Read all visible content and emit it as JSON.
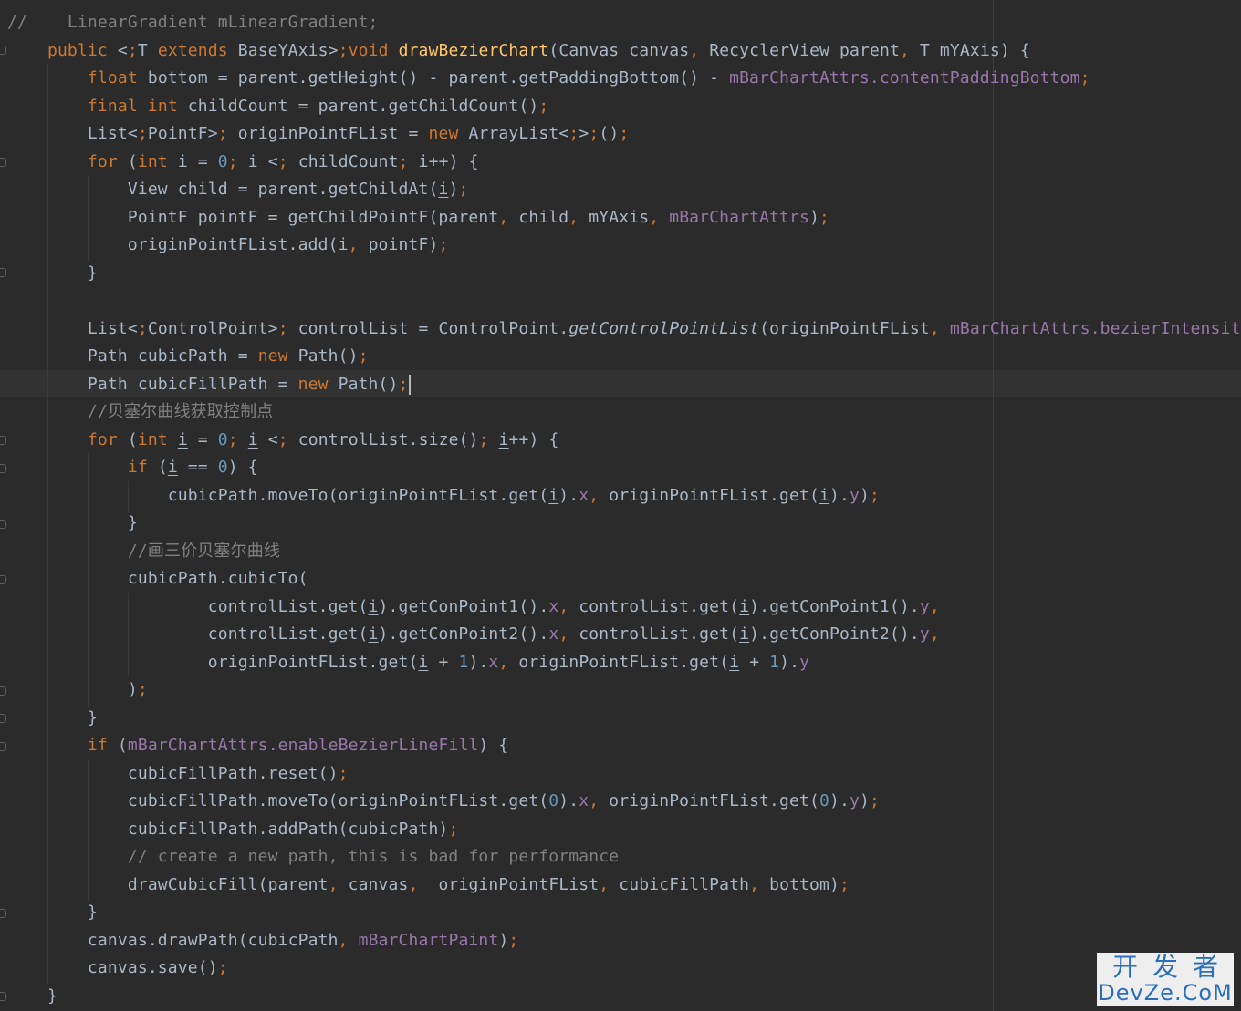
{
  "editor": {
    "lines": [
      "//    LinearGradient mLinearGradient;",
      "    public <T extends BaseYAxis>void drawBezierChart(Canvas canvas, RecyclerView parent, T mYAxis) {",
      "        float bottom = parent.getHeight() - parent.getPaddingBottom() - mBarChartAttrs.contentPaddingBottom;",
      "        final int childCount = parent.getChildCount();",
      "        List<PointF> originPointFList = new ArrayList<>();",
      "        for (int i = 0; i < childCount; i++) {",
      "            View child = parent.getChildAt(i);",
      "            PointF pointF = getChildPointF(parent, child, mYAxis, mBarChartAttrs);",
      "            originPointFList.add(i, pointF);",
      "        }",
      "",
      "        List<ControlPoint> controlList = ControlPoint.getControlPointList(originPointFList, mBarChartAttrs.bezierIntensity);",
      "        Path cubicPath = new Path();",
      "        Path cubicFillPath = new Path();",
      "        //贝塞尔曲线获取控制点",
      "        for (int i = 0; i < controlList.size(); i++) {",
      "            if (i == 0) {",
      "                cubicPath.moveTo(originPointFList.get(i).x, originPointFList.get(i).y);",
      "            }",
      "            //画三价贝塞尔曲线",
      "            cubicPath.cubicTo(",
      "                    controlList.get(i).getConPoint1().x, controlList.get(i).getConPoint1().y,",
      "                    controlList.get(i).getConPoint2().x, controlList.get(i).getConPoint2().y,",
      "                    originPointFList.get(i + 1).x, originPointFList.get(i + 1).y",
      "            );",
      "        }",
      "        if (mBarChartAttrs.enableBezierLineFill) {",
      "            cubicFillPath.reset();",
      "            cubicFillPath.moveTo(originPointFList.get(0).x, originPointFList.get(0).y);",
      "            cubicFillPath.addPath(cubicPath);",
      "            // create a new path, this is bad for performance",
      "            drawCubicFill(parent, canvas,  originPointFList, cubicFillPath, bottom);",
      "        }",
      "        canvas.drawPath(cubicPath, mBarChartPaint);",
      "        canvas.save();",
      "    }"
    ]
  },
  "watermark": {
    "cn": "开发者",
    "en": "DevZe.CoM"
  },
  "colors": {
    "background": "#2b2b2b",
    "keyword": "#cc7832",
    "field": "#9876aa",
    "method": "#ffc66d",
    "number": "#6897bb",
    "comment": "#808080",
    "text": "#a9b7c6"
  }
}
